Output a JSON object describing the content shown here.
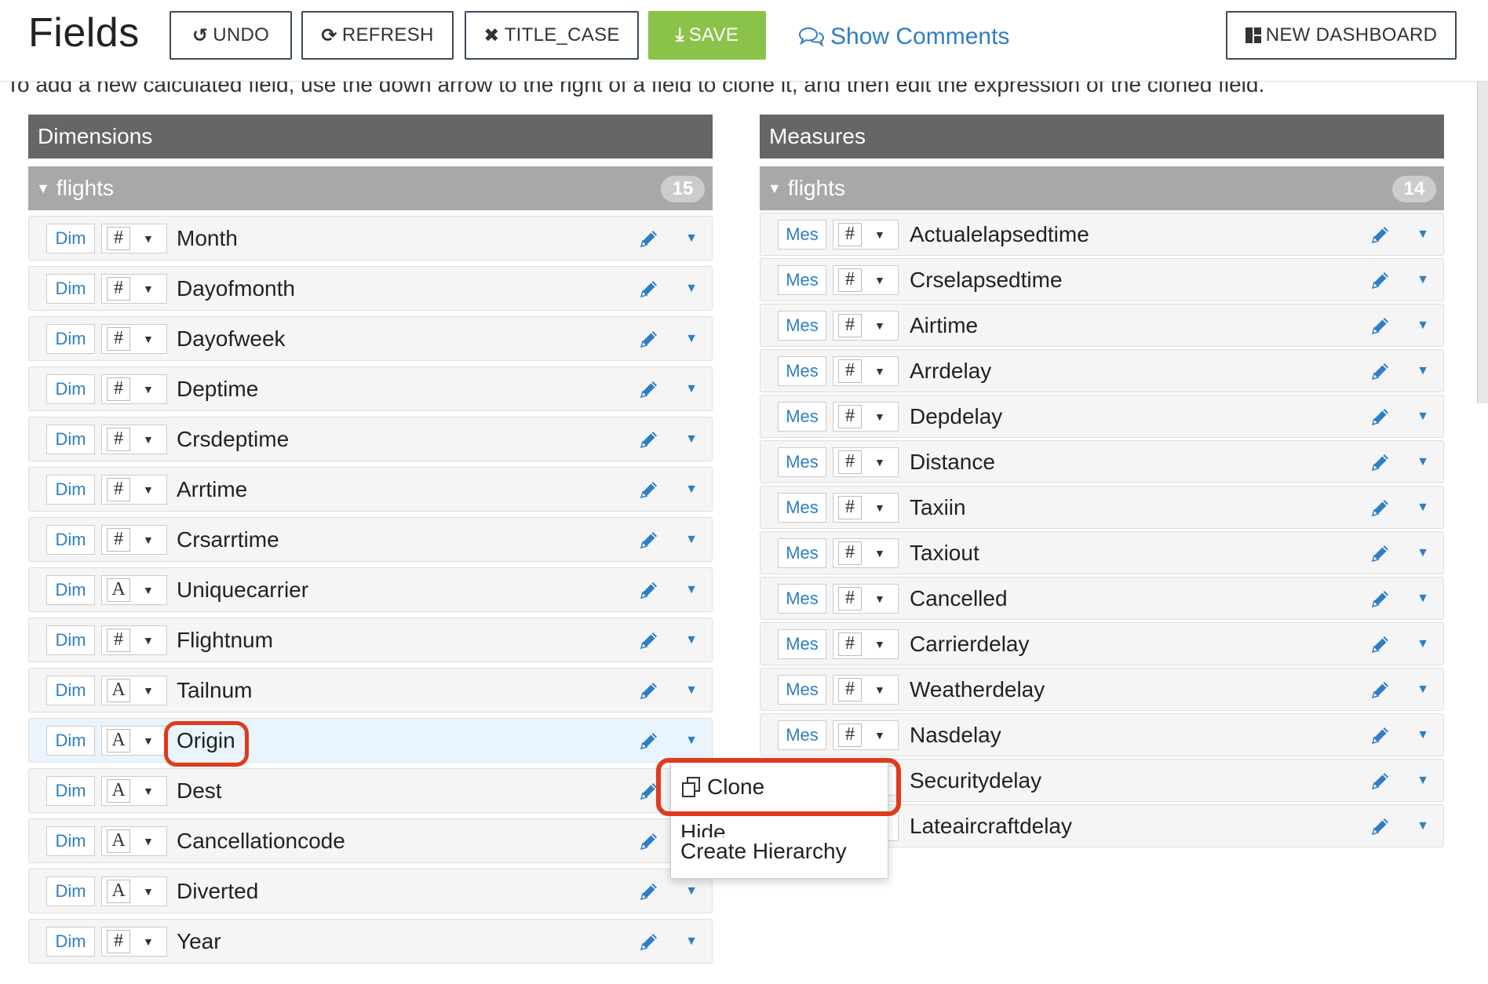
{
  "header": {
    "title": "Fields",
    "undo_label": "UNDO",
    "refresh_label": "REFRESH",
    "title_case_label": "TITLE_CASE",
    "save_label": "SAVE",
    "show_comments_label": "Show Comments",
    "new_dashboard_label": "NEW DASHBOARD"
  },
  "hint": "To add a new calculated field, use the down arrow to the right of a field to clone it, and then edit the expression of the cloned field.",
  "dimensions": {
    "title": "Dimensions",
    "group_name": "flights",
    "count": "15",
    "fields": [
      {
        "tag": "Dim",
        "type": "#",
        "name": "Month"
      },
      {
        "tag": "Dim",
        "type": "#",
        "name": "Dayofmonth"
      },
      {
        "tag": "Dim",
        "type": "#",
        "name": "Dayofweek"
      },
      {
        "tag": "Dim",
        "type": "#",
        "name": "Deptime"
      },
      {
        "tag": "Dim",
        "type": "#",
        "name": "Crsdeptime"
      },
      {
        "tag": "Dim",
        "type": "#",
        "name": "Arrtime"
      },
      {
        "tag": "Dim",
        "type": "#",
        "name": "Crsarrtime"
      },
      {
        "tag": "Dim",
        "type": "A",
        "name": "Uniquecarrier"
      },
      {
        "tag": "Dim",
        "type": "#",
        "name": "Flightnum"
      },
      {
        "tag": "Dim",
        "type": "A",
        "name": "Tailnum"
      },
      {
        "tag": "Dim",
        "type": "A",
        "name": "Origin"
      },
      {
        "tag": "Dim",
        "type": "A",
        "name": "Dest"
      },
      {
        "tag": "Dim",
        "type": "A",
        "name": "Cancellationcode"
      },
      {
        "tag": "Dim",
        "type": "A",
        "name": "Diverted"
      },
      {
        "tag": "Dim",
        "type": "#",
        "name": "Year"
      }
    ]
  },
  "measures": {
    "title": "Measures",
    "group_name": "flights",
    "count": "14",
    "fields": [
      {
        "tag": "Mes",
        "type": "#",
        "name": "Actualelapsedtime"
      },
      {
        "tag": "Mes",
        "type": "#",
        "name": "Crselapsedtime"
      },
      {
        "tag": "Mes",
        "type": "#",
        "name": "Airtime"
      },
      {
        "tag": "Mes",
        "type": "#",
        "name": "Arrdelay"
      },
      {
        "tag": "Mes",
        "type": "#",
        "name": "Depdelay"
      },
      {
        "tag": "Mes",
        "type": "#",
        "name": "Distance"
      },
      {
        "tag": "Mes",
        "type": "#",
        "name": "Taxiin"
      },
      {
        "tag": "Mes",
        "type": "#",
        "name": "Taxiout"
      },
      {
        "tag": "Mes",
        "type": "#",
        "name": "Cancelled"
      },
      {
        "tag": "Mes",
        "type": "#",
        "name": "Carrierdelay"
      },
      {
        "tag": "Mes",
        "type": "#",
        "name": "Weatherdelay"
      },
      {
        "tag": "Mes",
        "type": "#",
        "name": "Nasdelay"
      },
      {
        "tag": "Mes",
        "type": "#",
        "name": "Securitydelay"
      },
      {
        "tag": "Mes",
        "type": "#",
        "name": "Lateaircraftdelay"
      }
    ]
  },
  "context_menu": {
    "items": [
      "Clone",
      "Hide",
      "Create Hierarchy"
    ]
  },
  "icons": {
    "undo": "undo-icon",
    "refresh": "refresh-icon",
    "close": "close-icon",
    "download": "download-icon",
    "comments": "comments-icon",
    "dashboard": "dashboard-icon",
    "edit": "pencil-icon",
    "more": "caret-down-icon",
    "clone": "copy-icon"
  },
  "colors": {
    "accent": "#2f7ec4",
    "save": "#8bc34a",
    "panel_header": "#666666",
    "group_header": "#a8a8a8",
    "annotation": "#e0391e"
  }
}
